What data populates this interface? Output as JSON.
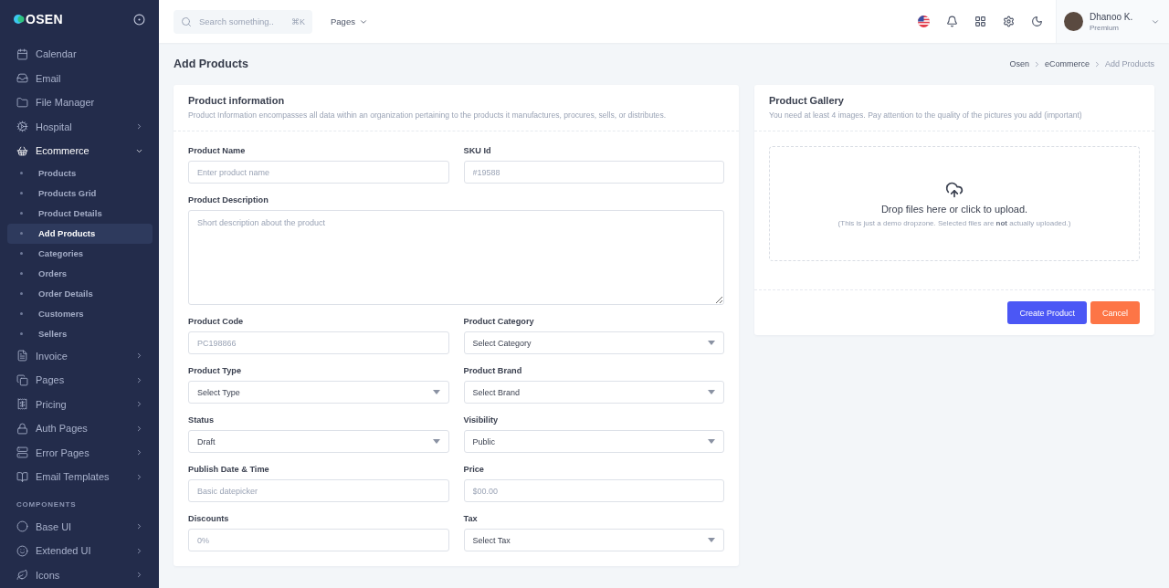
{
  "sidebar": {
    "logo": "OSEN",
    "sections": [
      {
        "items": [
          {
            "label": "Calendar",
            "has_children": false,
            "expanded": false,
            "selected": false
          },
          {
            "label": "Email",
            "has_children": false,
            "expanded": false,
            "selected": false
          },
          {
            "label": "File Manager",
            "has_children": false,
            "expanded": false,
            "selected": false
          },
          {
            "label": "Hospital",
            "has_children": true,
            "expanded": false,
            "selected": false
          },
          {
            "label": "Ecommerce",
            "has_children": true,
            "expanded": true,
            "selected": false,
            "children": [
              {
                "label": "Products",
                "selected": false
              },
              {
                "label": "Products Grid",
                "selected": false
              },
              {
                "label": "Product Details",
                "selected": false
              },
              {
                "label": "Add Products",
                "selected": true
              },
              {
                "label": "Categories",
                "selected": false
              },
              {
                "label": "Orders",
                "selected": false
              },
              {
                "label": "Order Details",
                "selected": false
              },
              {
                "label": "Customers",
                "selected": false
              },
              {
                "label": "Sellers",
                "selected": false
              }
            ]
          },
          {
            "label": "Invoice",
            "has_children": true,
            "expanded": false,
            "selected": false
          },
          {
            "label": "Pages",
            "has_children": true,
            "expanded": false,
            "selected": false
          },
          {
            "label": "Pricing",
            "has_children": true,
            "expanded": false,
            "selected": false
          },
          {
            "label": "Auth Pages",
            "has_children": true,
            "expanded": false,
            "selected": false
          },
          {
            "label": "Error Pages",
            "has_children": true,
            "expanded": false,
            "selected": false
          },
          {
            "label": "Email Templates",
            "has_children": true,
            "expanded": false,
            "selected": false
          }
        ]
      },
      {
        "title": "COMPONENTS",
        "items": [
          {
            "label": "Base UI",
            "has_children": true,
            "expanded": false,
            "selected": false
          },
          {
            "label": "Extended UI",
            "has_children": true,
            "expanded": false,
            "selected": false
          },
          {
            "label": "Icons",
            "has_children": true,
            "expanded": false,
            "selected": false
          }
        ]
      }
    ]
  },
  "topbar": {
    "search": {
      "placeholder": "Search something..",
      "shortcut": "⌘K"
    },
    "menu": "Pages",
    "user": {
      "name": "Dhanoo K.",
      "plan": "Premium"
    }
  },
  "page": {
    "title": "Add Products",
    "breadcrumb": [
      "Osen",
      "eCommerce",
      "Add Products"
    ]
  },
  "product_information": {
    "title": "Product information",
    "subtitle": "Product Information encompasses all data within an organization pertaining to the products it manufactures, procures, sells, or distributes.",
    "fields": [
      {
        "label": "Product Name",
        "kind": "input",
        "placeholder": "Enter product name"
      },
      {
        "label": "SKU Id",
        "kind": "input",
        "placeholder": "#19588"
      },
      {
        "label": "Product Description",
        "kind": "textarea",
        "placeholder": "Short description about the product"
      },
      {
        "label": "Product Code",
        "kind": "input",
        "placeholder": "PC198866"
      },
      {
        "label": "Product Category",
        "kind": "select",
        "value": "Select Category"
      },
      {
        "label": "Product Type",
        "kind": "select",
        "value": "Select Type"
      },
      {
        "label": "Product Brand",
        "kind": "select",
        "value": "Select Brand"
      },
      {
        "label": "Status",
        "kind": "select",
        "value": "Draft"
      },
      {
        "label": "Visibility",
        "kind": "select",
        "value": "Public"
      },
      {
        "label": "Publish Date & Time",
        "kind": "input",
        "placeholder": "Basic datepicker"
      },
      {
        "label": "Price",
        "kind": "input",
        "placeholder": "$00.00"
      },
      {
        "label": "Discounts",
        "kind": "input",
        "placeholder": "0%"
      },
      {
        "label": "Tax",
        "kind": "select",
        "value": "Select Tax"
      }
    ]
  },
  "product_gallery": {
    "title": "Product Gallery",
    "subtitle": "You need at least 4 images. Pay attention to the quality of the pictures you add (important)",
    "dropzone": {
      "title": "Drop files here or click to upload.",
      "note": "(This is just a demo dropzone. Selected files are **not** actually uploaded.)"
    },
    "buttons": [
      {
        "label": "Create Product",
        "kind": "primary"
      },
      {
        "label": "Cancel",
        "kind": "danger"
      }
    ]
  }
}
